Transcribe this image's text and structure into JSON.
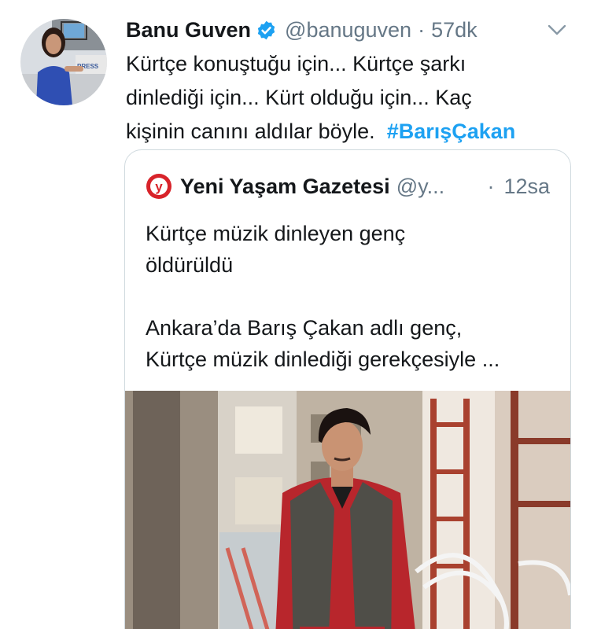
{
  "tweet": {
    "author_name": "Banu Guven",
    "handle": "@banuguven",
    "separator": "·",
    "time": "57dk",
    "text_lines": [
      "Kürtçe konuştuğu için... Kürtçe şarkı",
      "dinlediği için... Kürt olduğu için... Kaç",
      "kişinin canını aldılar böyle."
    ],
    "hashtag": "#BarışÇakan",
    "avatar_badge": "PRESS"
  },
  "quote": {
    "author_name": "Yeni Yaşam Gazetesi",
    "handle": "@y...",
    "separator": "·",
    "time": "12sa",
    "logo_letter": "y",
    "headline_lines": [
      "Kürtçe müzik dinleyen genç",
      "öldürüldü"
    ],
    "body_lines": [
      "Ankara’da Barış Çakan adlı genç,",
      "Kürtçe müzik dinlediği gerekçesiyle ..."
    ]
  },
  "colors": {
    "text": "#14171a",
    "secondary": "#657786",
    "link": "#1da1f2",
    "verified": "#1da1f2",
    "border": "#cfd9de",
    "logo_red": "#d8232a"
  },
  "icons": {
    "verified": "verified-badge-icon",
    "caret": "chevron-down-icon"
  }
}
